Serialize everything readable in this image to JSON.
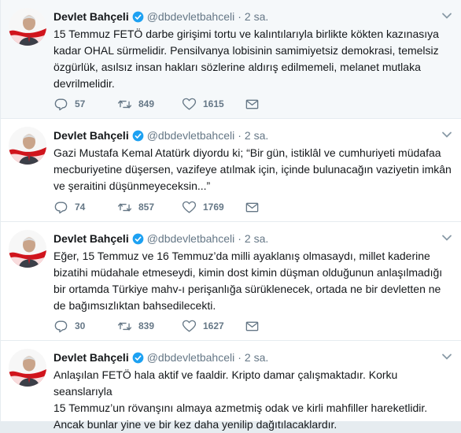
{
  "colors": {
    "verified": "#1da1f2",
    "muted": "#657786",
    "text": "#14171a",
    "avatar_red": "#d0141c"
  },
  "tweets": [
    {
      "name": "Devlet Bahçeli",
      "handle": "@dbdevletbahceli",
      "separator": "·",
      "time": "2 sa.",
      "lines": [
        "15 Temmuz FETÖ darbe girişimi tortu ve kalıntılarıyla birlikte kökten kazınasıya",
        "kadar OHAL sürmelidir. Pensilvanya lobisinin samimiyetsiz demokrasi, temelsiz",
        "özgürlük, asılsız insan hakları sözlerine aldırış edilmemeli, melanet mutlaka",
        "devrilmelidir."
      ],
      "replies": "57",
      "retweets": "849",
      "likes": "1615"
    },
    {
      "name": "Devlet Bahçeli",
      "handle": "@dbdevletbahceli",
      "separator": "·",
      "time": "2 sa.",
      "lines": [
        "Gazi Mustafa Kemal Atatürk diyordu ki; “Bir gün, istiklâl ve cumhuriyeti müdafaa",
        "mecburiyetine düşersen, vazifeye atılmak için, içinde bulunacağın vaziyetin imkân",
        "ve şeraitini düşünmeyeceksin...”"
      ],
      "replies": "74",
      "retweets": "857",
      "likes": "1769"
    },
    {
      "name": "Devlet Bahçeli",
      "handle": "@dbdevletbahceli",
      "separator": "·",
      "time": "2 sa.",
      "lines": [
        "Eğer, 15 Temmuz ve 16 Temmuz’da milli ayaklanış olmasaydı, millet kaderine",
        "bizatihi müdahale etmeseydi, kimin dost kimin düşman olduğunun anlaşılmadığı",
        "bir ortamda Türkiye mahv-ı perişanlığa sürüklenecek, ortada ne bir devletten ne",
        "de bağımsızlıktan bahsedilecekti."
      ],
      "replies": "30",
      "retweets": "839",
      "likes": "1627"
    },
    {
      "name": "Devlet Bahçeli",
      "handle": "@dbdevletbahceli",
      "separator": "·",
      "time": "2 sa.",
      "lines": [
        "Anlaşılan FETÖ hala aktif ve faaldir. Kripto damar çalışmaktadır. Korku seanslarıyla",
        "15 Temmuz’un rövanşını almaya azmetmiş odak ve kirli mahfiller hareketlidir.",
        "Ancak bunlar yine ve bir kez daha yenilip dağıtılacaklardır."
      ]
    }
  ]
}
